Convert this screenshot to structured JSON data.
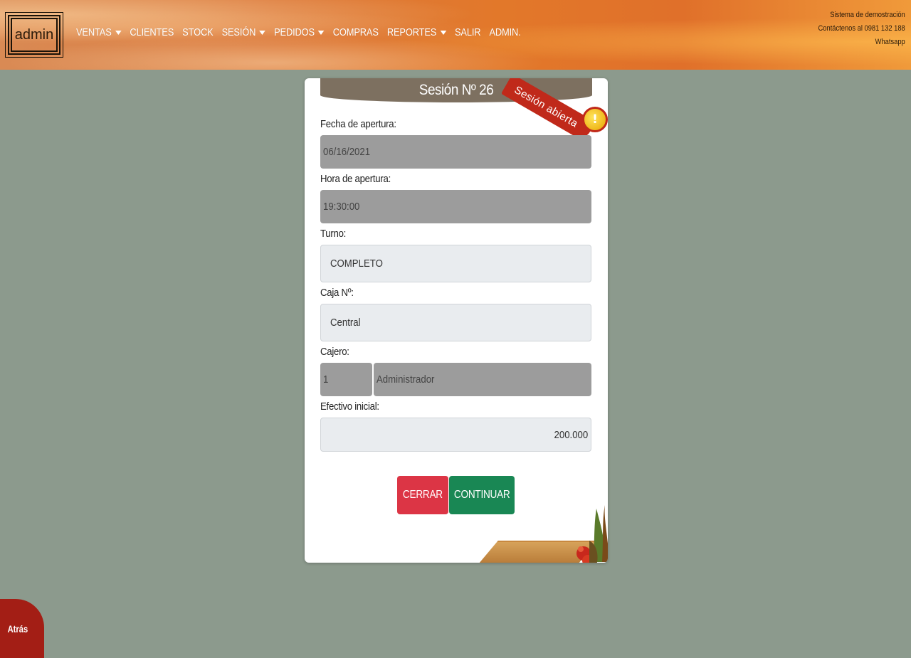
{
  "brand": {
    "label": "admin"
  },
  "nav": {
    "items": [
      {
        "label": "VENTAS",
        "dropdown": true
      },
      {
        "label": "CLIENTES",
        "dropdown": false
      },
      {
        "label": "STOCK",
        "dropdown": false
      },
      {
        "label": "SESIÓN",
        "dropdown": true
      },
      {
        "label": "PEDIDOS",
        "dropdown": true
      },
      {
        "label": "COMPRAS",
        "dropdown": false
      },
      {
        "label": "REPORTES",
        "dropdown": true
      },
      {
        "label": "SALIR",
        "dropdown": false
      },
      {
        "label": "ADMIN.",
        "dropdown": false
      }
    ]
  },
  "info": {
    "line1": "Sistema de demostración",
    "line2": "Contáctenos al 0981 132 188",
    "line3": "Whatsapp"
  },
  "card": {
    "title": "Sesión Nº 26",
    "ribbon": "Sesión abierta",
    "ribbon_icon": "exclamation-icon",
    "fields": {
      "fecha_label": "Fecha de apertura:",
      "fecha_value": "06/16/2021",
      "hora_label": "Hora de apertura:",
      "hora_value": "19:30:00",
      "turno_label": "Turno:",
      "turno_value": "COMPLETO",
      "caja_label": "Caja Nº:",
      "caja_value": "Central",
      "cajero_label": "Cajero:",
      "cajero_id": "1",
      "cajero_name": "Administrador",
      "efectivo_label": "Efectivo inicial:",
      "efectivo_value": "200.000"
    },
    "buttons": {
      "cerrar": "CERRAR",
      "continuar": "CONTINUAR"
    }
  },
  "back": {
    "label": "Atrás"
  },
  "colors": {
    "background": "#8c9a8d",
    "header": "#7d7060",
    "ribbon": "#c0291a",
    "danger": "#dc3545",
    "success": "#198754",
    "back": "#a31e15"
  }
}
